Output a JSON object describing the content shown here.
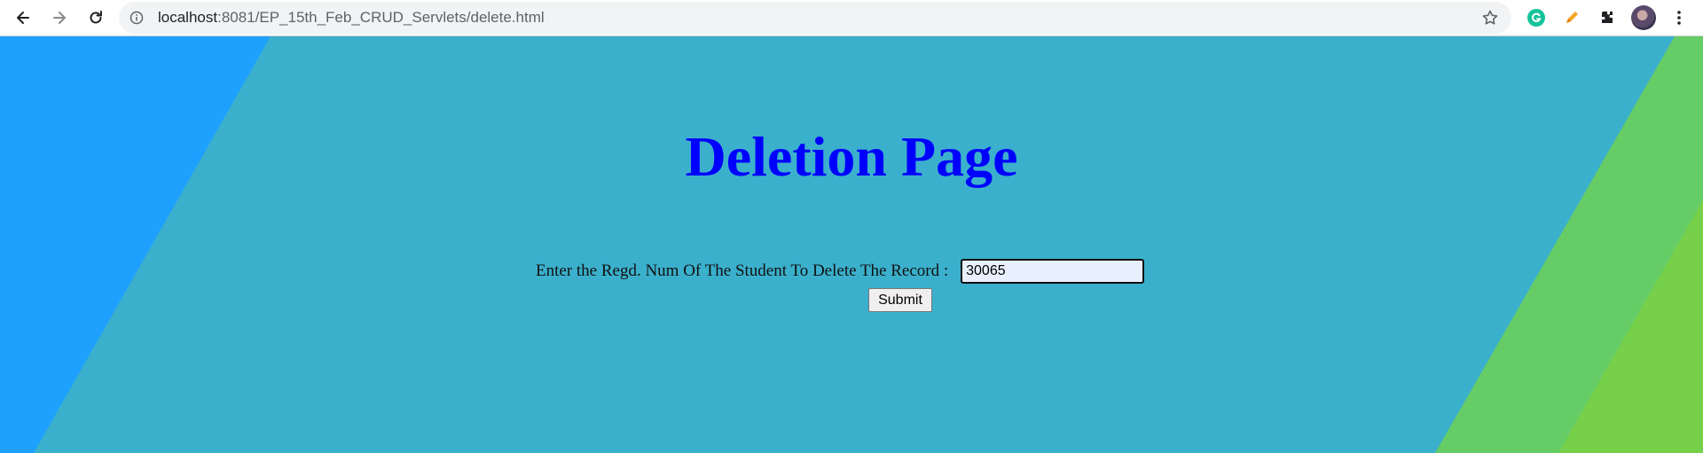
{
  "browser": {
    "url_host": "localhost",
    "url_path": ":8081/EP_15th_Feb_CRUD_Servlets/delete.html",
    "icons": [
      "back-arrow-icon",
      "forward-arrow-icon",
      "reload-icon",
      "site-info-icon",
      "bookmark-star-icon",
      "grammarly-extension-icon",
      "pencil-extension-icon",
      "extensions-puzzle-icon",
      "profile-avatar",
      "more-menu-icon"
    ]
  },
  "page": {
    "heading": "Deletion Page",
    "form": {
      "label": "Enter the Regd. Num Of The Student To Delete The Record :",
      "input_value": "30065",
      "submit_label": "Submit"
    },
    "colors": {
      "heading": "#0000ff",
      "background_main": "#3bb0cc",
      "background_left": "#1ea0ff",
      "background_right": "#66cc66",
      "background_right_far": "#77d04a"
    }
  }
}
